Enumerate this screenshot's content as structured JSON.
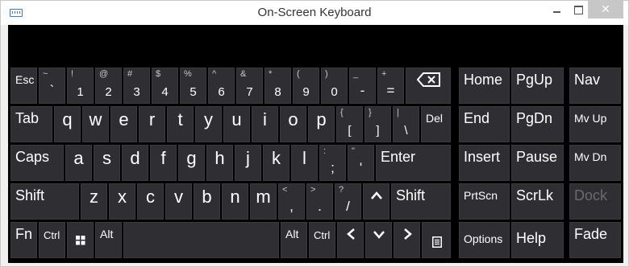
{
  "window": {
    "title": "On-Screen Keyboard"
  },
  "controls": {
    "minimize": "minimize",
    "maximize": "maximize",
    "close": "close"
  },
  "keys": {
    "esc": "Esc",
    "tilde": {
      "shift": "~",
      "main": "`"
    },
    "d1": {
      "shift": "!",
      "main": "1"
    },
    "d2": {
      "shift": "@",
      "main": "2"
    },
    "d3": {
      "shift": "#",
      "main": "3"
    },
    "d4": {
      "shift": "$",
      "main": "4"
    },
    "d5": {
      "shift": "%",
      "main": "5"
    },
    "d6": {
      "shift": "^",
      "main": "6"
    },
    "d7": {
      "shift": "&",
      "main": "7"
    },
    "d8": {
      "shift": "*",
      "main": "8"
    },
    "d9": {
      "shift": "(",
      "main": "9"
    },
    "d0": {
      "shift": ")",
      "main": "0"
    },
    "minus": {
      "shift": "_",
      "main": "-"
    },
    "equals": {
      "shift": "+",
      "main": "="
    },
    "tab": "Tab",
    "q": "q",
    "w": "w",
    "e": "e",
    "r": "r",
    "t": "t",
    "y": "y",
    "u": "u",
    "i": "i",
    "o": "o",
    "p": "p",
    "lbracket": {
      "shift": "{",
      "main": "["
    },
    "rbracket": {
      "shift": "}",
      "main": "]"
    },
    "backslash": {
      "shift": "|",
      "main": "\\"
    },
    "del": "Del",
    "caps": "Caps",
    "a": "a",
    "s": "s",
    "d": "d",
    "f": "f",
    "g": "g",
    "h": "h",
    "j": "j",
    "k": "k",
    "l": "l",
    "semicolon": {
      "shift": ":",
      "main": ";"
    },
    "quote": {
      "shift": "\"",
      "main": "'"
    },
    "enter": "Enter",
    "shift_left": "Shift",
    "z": "z",
    "x": "x",
    "c": "c",
    "v": "v",
    "b": "b",
    "n": "n",
    "m": "m",
    "comma": {
      "shift": "<",
      "main": ","
    },
    "period": {
      "shift": ">",
      "main": "."
    },
    "slash": {
      "shift": "?",
      "main": "/"
    },
    "shift_right": "Shift",
    "fn": "Fn",
    "ctrl_left": "Ctrl",
    "alt_left": "Alt",
    "alt_right": "Alt",
    "ctrl_right": "Ctrl",
    "home": "Home",
    "pgup": "PgUp",
    "nav": "Nav",
    "end": "End",
    "pgdn": "PgDn",
    "mvup": "Mv Up",
    "insert": "Insert",
    "pause": "Pause",
    "mvdn": "Mv Dn",
    "prtscn": "PrtScn",
    "scrlk": "ScrLk",
    "dock": "Dock",
    "options": "Options",
    "help": "Help",
    "fade": "Fade"
  },
  "icons": {
    "backspace": "backspace-icon",
    "windows": "windows-logo-icon",
    "arrow_up": "arrow-up-icon",
    "arrow_left": "arrow-left-icon",
    "arrow_down": "arrow-down-icon",
    "arrow_right": "arrow-right-icon",
    "menu": "context-menu-icon"
  },
  "colors": {
    "key_bg": "#2f2f33",
    "board_bg": "#000000",
    "disabled_text": "#6b6b6b"
  }
}
